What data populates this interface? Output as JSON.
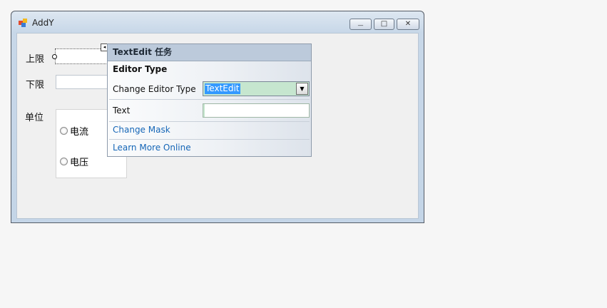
{
  "window": {
    "title": "AddY",
    "min_glyph": "—",
    "max_glyph": "□",
    "close_glyph": "✕"
  },
  "form": {
    "upper_label": "上限",
    "lower_label": "下限",
    "unit_label": "单位",
    "radio_current": "电流",
    "radio_voltage": "电压"
  },
  "panel": {
    "title": "TextEdit 任务",
    "section": "Editor Type",
    "change_editor_label": "Change Editor Type",
    "editor_type_value": "TextEdit",
    "text_label": "Text",
    "text_value": "",
    "change_mask": "Change Mask",
    "learn_more": "Learn More Online",
    "dropdown_glyph": "▼",
    "smart_tag_glyph": "◂"
  },
  "colors": {
    "selection": "#3399ff",
    "combo_background": "#c6e6cf",
    "link": "#1566b7",
    "panel_header": "#bccadb"
  }
}
